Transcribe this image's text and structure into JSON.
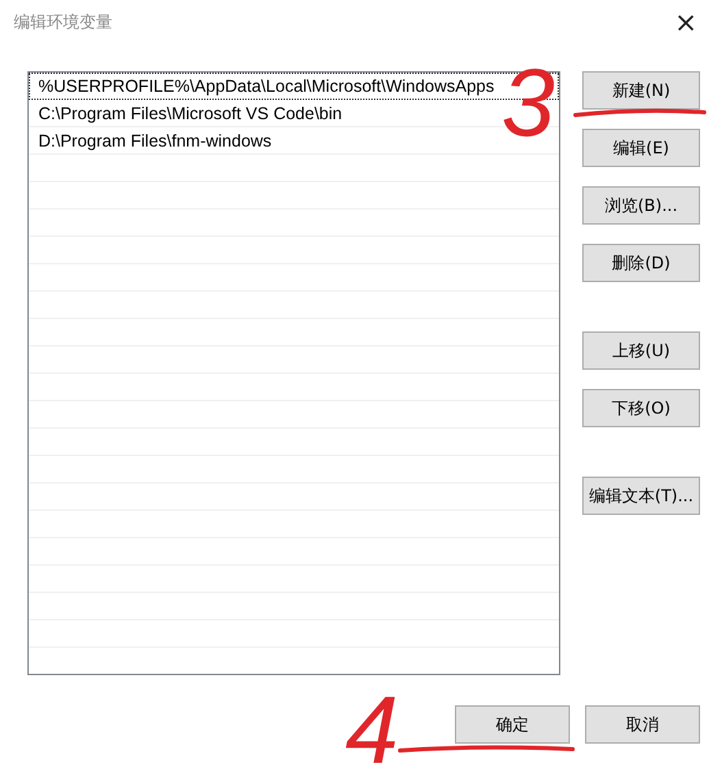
{
  "window": {
    "title": "编辑环境变量",
    "close": "×"
  },
  "paths": [
    {
      "text": "%USERPROFILE%\\AppData\\Local\\Microsoft\\WindowsApps",
      "selected": true
    },
    {
      "text": "C:\\Program Files\\Microsoft VS Code\\bin",
      "selected": false
    },
    {
      "text": "D:\\Program Files\\fnm-windows",
      "selected": false
    }
  ],
  "button_groups": [
    [
      "新建(N)",
      "编辑(E)",
      "浏览(B)...",
      "删除(D)"
    ],
    [
      "上移(U)",
      "下移(O)"
    ],
    [
      "编辑文本(T)..."
    ]
  ],
  "footer_buttons": [
    "确定",
    "取消"
  ],
  "annotations": [
    {
      "text": "3"
    },
    {
      "text": "4"
    }
  ]
}
